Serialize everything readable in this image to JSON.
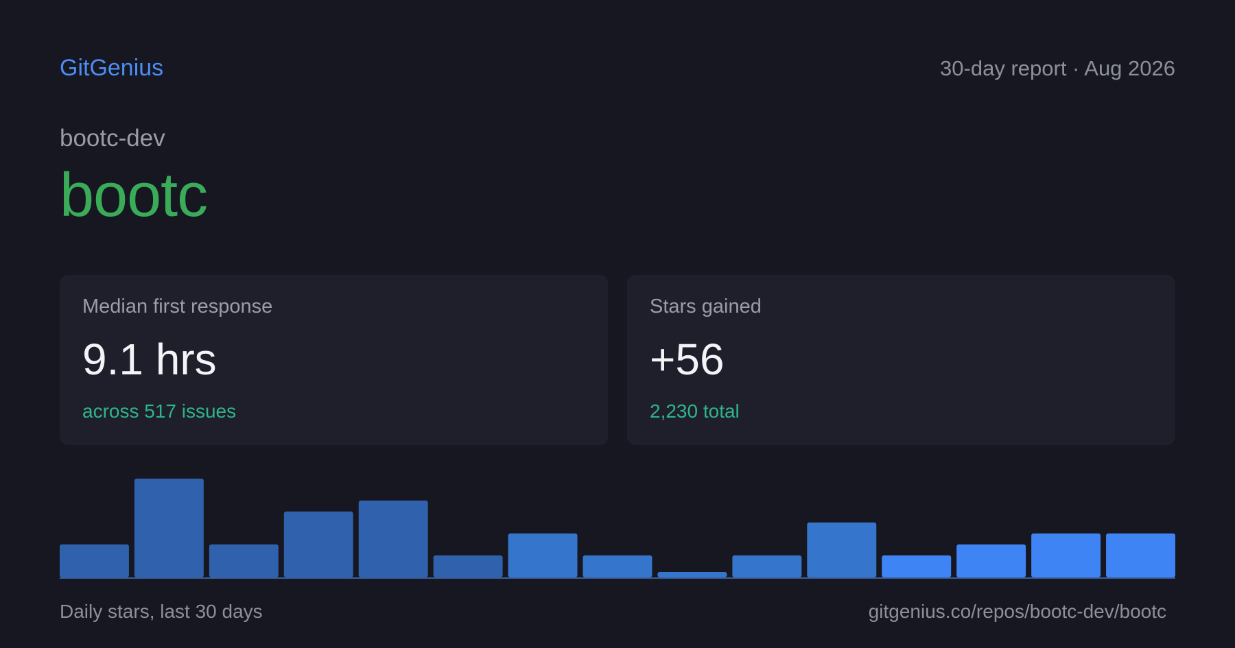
{
  "header": {
    "brand": "GitGenius",
    "report_label": "30-day report · Aug 2026"
  },
  "repo": {
    "owner": "bootc-dev",
    "name": "bootc"
  },
  "cards": {
    "response": {
      "label": "Median first response",
      "value": "9.1 hrs",
      "sub": "across 517 issues"
    },
    "stars": {
      "label": "Stars gained",
      "value": "+56",
      "sub": "2,230 total"
    }
  },
  "footer": {
    "caption": "Daily stars, last 30 days",
    "url": "gitgenius.co/repos/bootc-dev/bootc"
  },
  "chart_data": {
    "type": "bar",
    "values": [
      3,
      9,
      3,
      6,
      7,
      2,
      4,
      2,
      0.5,
      2,
      5,
      2,
      3,
      4,
      4
    ],
    "ylim": [
      0,
      9
    ],
    "colors": [
      "#2f61ad",
      "#2f61ad",
      "#2f61ad",
      "#2f61ad",
      "#2f61ad",
      "#2f61ad",
      "#3576cc",
      "#3576cc",
      "#3576cc",
      "#3576cc",
      "#3576cc",
      "#3f84f4",
      "#3f84f4",
      "#3f84f4",
      "#3f84f4"
    ],
    "baseline_color": "#3a5f9f"
  }
}
